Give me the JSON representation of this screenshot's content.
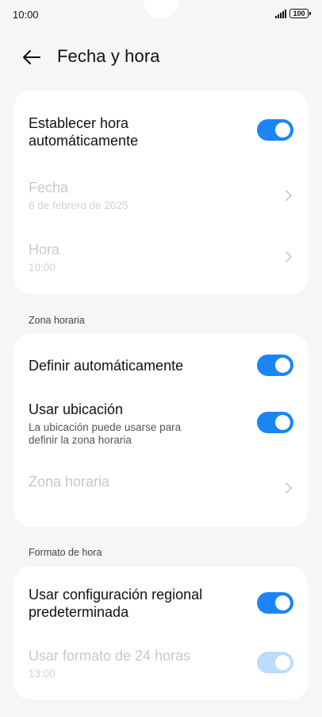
{
  "status_bar": {
    "time": "10:00",
    "battery": "100"
  },
  "header": {
    "title": "Fecha y hora"
  },
  "card1": {
    "auto_time": {
      "label": "Establecer hora automáticamente",
      "on": true
    },
    "date": {
      "label": "Fecha",
      "value": "6 de febrero de 2025"
    },
    "time": {
      "label": "Hora",
      "value": "10:00"
    }
  },
  "section_timezone": {
    "label": "Zona horaria"
  },
  "card2": {
    "auto_define": {
      "label": "Definir automáticamente",
      "on": true
    },
    "use_location": {
      "label": "Usar ubicación",
      "description": "La ubicación puede usarse para definir la zona horaria",
      "on": true
    },
    "timezone": {
      "label": "Zona horaria"
    }
  },
  "section_format": {
    "label": "Formato de hora"
  },
  "card3": {
    "regional": {
      "label": "Usar configuración regional predeterminada",
      "on": true
    },
    "format24": {
      "label": "Usar formato de 24 horas",
      "value": "13:00",
      "on": true
    }
  },
  "colors": {
    "accent": "#1a85f5",
    "accent_disabled": "#bcdcfc",
    "background": "#f6f6f6"
  },
  "icons": {
    "back": "arrow-left-icon",
    "chevron": "chevron-right-icon",
    "signal": "signal-icon",
    "battery": "battery-icon"
  }
}
